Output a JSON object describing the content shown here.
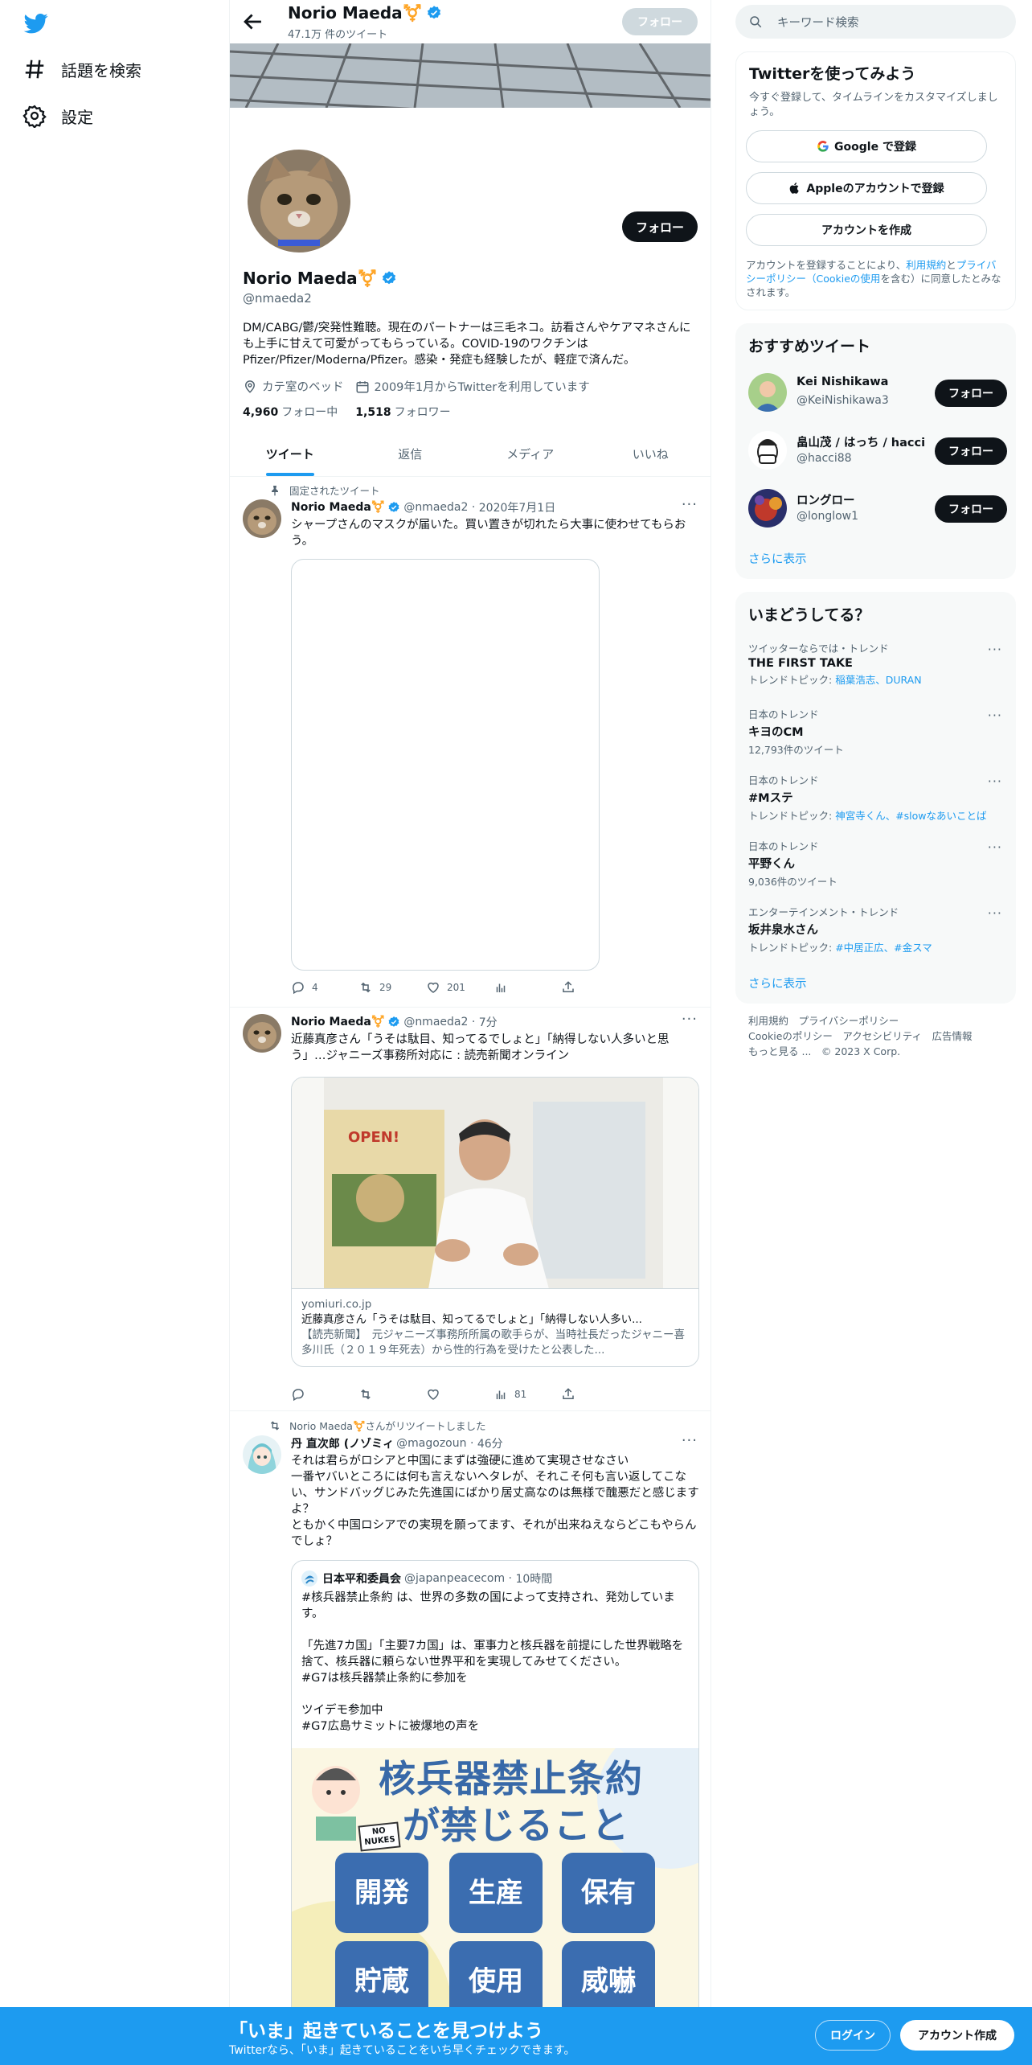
{
  "nav": {
    "items": [
      {
        "label": "話題を検索",
        "icon": "hash-icon"
      },
      {
        "label": "設定",
        "icon": "gear-icon"
      }
    ]
  },
  "topbar": {
    "name": "Norio Maeda⚧️",
    "tweet_count": "47.1万 件のツイート",
    "follow_label": "フォロー"
  },
  "profile": {
    "name": "Norio Maeda⚧️",
    "handle": "@nmaeda2",
    "follow_label": "フォロー",
    "bio": "DM/CABG/鬱/突発性難聴。現在のパートナーは三毛ネコ。訪看さんやケアマネさんにも上手に甘えて可愛がってもらっている。COVID-19のワクチンはPfizer/Pfizer/Moderna/Pfizer。感染・発症も経験したが、軽症で済んだ。",
    "location": "カテ室のベッド",
    "joined": "2009年1月からTwitterを利用しています",
    "following_count": "4,960",
    "following_label": "フォロー中",
    "followers_count": "1,518",
    "followers_label": "フォロワー"
  },
  "tabs": [
    "ツイート",
    "返信",
    "メディア",
    "いいね"
  ],
  "tweets": [
    {
      "context": "固定されたツイート",
      "name": "Norio Maeda⚧️",
      "handle": "@nmaeda2",
      "time": "2020年7月1日",
      "text": "シャープさんのマスクが届いた。買い置きが切れたら大事に使わせてもらおう。",
      "replies": "4",
      "retweets": "29",
      "likes": "201"
    },
    {
      "name": "Norio Maeda⚧️",
      "handle": "@nmaeda2",
      "time": "7分",
      "text": "近藤真彦さん「うそは駄目、知ってるでしょと」「納得しない人多いと思う」…ジャニーズ事務所対応に : 読売新聞オンライン",
      "card": {
        "domain": "yomiuri.co.jp",
        "title": "近藤真彦さん「うそは駄目、知ってるでしょと」「納得しない人多い...",
        "desc": "【読売新聞】　元ジャニーズ事務所所属の歌手らが、当時社長だったジャニー喜多川氏（２０１９年死去）から性的行為を受けたと公表した...",
        "sign_text": "OPEN!"
      },
      "views": "81"
    },
    {
      "context": "Norio Maeda⚧️さんがリツイートしました",
      "name": "丹 直次郎 (ノゾミィ",
      "handle": "@magozoun",
      "time": "46分",
      "text": "それは君らがロシアと中国にまずは強硬に進めて実現させなさい\n一番ヤバいところには何も言えないヘタレが、それこそ何も言い返してこない、サンドバッグじみた先進国にばかり居丈高なのは無様で醜悪だと感じますよ？\nともかく中国ロシアでの実現を願ってます、それが出来ねえならどこもやらんでしょ？",
      "quote": {
        "name": "日本平和委員会",
        "handle": "@japanpeacecom",
        "time": "10時間",
        "text": "#核兵器禁止条約 は、世界の多数の国によって支持され、発効しています。\n\n「先進7カ国」「主要7カ国」は、軍事力と核兵器を前提にした世界戦略を捨て、核兵器に頼らない世界平和を実現してみせてください。\n#G7は核兵器禁止条約に参加を\n\nツイデモ参加中\n#G7広島サミットに被爆地の声を",
        "image_title_1": "核兵器禁止条約",
        "image_title_2": "が禁じること",
        "badge": "NO NUKES",
        "boxes": [
          "開発",
          "生産",
          "保有",
          "貯蔵",
          "使用",
          "威嚇"
        ]
      }
    }
  ],
  "right": {
    "search_placeholder": "キーワード検索",
    "signup": {
      "title": "Twitterを使ってみよう",
      "subtitle": "今すぐ登録して、タイムラインをカスタマイズしましょう。",
      "google": "Google で登録",
      "apple": "Appleのアカウントで登録",
      "create": "アカウントを作成",
      "terms_a": "アカウントを登録することにより、",
      "terms_link1": "利用規約",
      "terms_b": "と",
      "terms_link2": "プライバシーポリシー（Cookieの使用",
      "terms_c": "を含む）に同意したとみなされます。"
    },
    "recommend": {
      "title": "おすすめツイート",
      "users": [
        {
          "name": "Kei Nishikawa",
          "handle": "@KeiNishikawa3"
        },
        {
          "name": "畠山茂 / はっち / hacci",
          "handle": "@hacci88"
        },
        {
          "name": "ロングロー",
          "handle": "@longlow1"
        }
      ],
      "follow_label": "フォロー",
      "show_more": "さらに表示"
    },
    "trends": {
      "title": "いまどうしてる？",
      "items": [
        {
          "category": "ツイッターならでは・トレンド",
          "name": "THE FIRST TAKE",
          "sub_prefix": "トレンドトピック: ",
          "sub_links": "稲葉浩志、DURAN"
        },
        {
          "category": "日本のトレンド",
          "name": "キヨのCM",
          "sub_prefix": "12,793件のツイート",
          "sub_links": ""
        },
        {
          "category": "日本のトレンド",
          "name": "#Mステ",
          "sub_prefix": "トレンドトピック: ",
          "sub_links": "神宮寺くん、#slowなあいことば"
        },
        {
          "category": "日本のトレンド",
          "name": "平野くん",
          "sub_prefix": "9,036件のツイート",
          "sub_links": ""
        },
        {
          "category": "エンターテインメント・トレンド",
          "name": "坂井泉水さん",
          "sub_prefix": "トレンドトピック: ",
          "sub_links": "#中居正広、#金スマ"
        }
      ],
      "show_more": "さらに表示"
    },
    "footer": {
      "line1": "利用規約　プライバシーポリシー",
      "line2": "Cookieのポリシー　アクセシビリティ　広告情報",
      "line3": "もっと見る ...　© 2023 X Corp."
    }
  },
  "bottombar": {
    "title": "「いま」起きていることを見つけよう",
    "subtitle": "Twitterなら、「いま」起きていることをいち早くチェックできます。",
    "login": "ログイン",
    "signup": "アカウント作成"
  },
  "colors": {
    "accent": "#1d9bf0",
    "text": "#0f1419",
    "muted": "#536471"
  }
}
